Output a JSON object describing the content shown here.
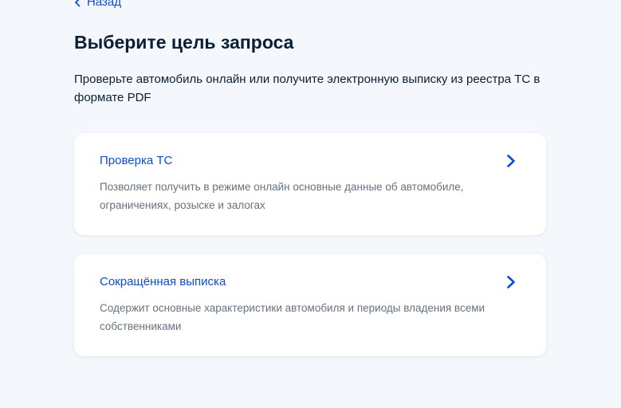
{
  "navigation": {
    "back_label": "Назад",
    "back_icon": "chevron-left-icon"
  },
  "header": {
    "title": "Выберите цель запроса",
    "subtitle": "Проверьте автомобиль онлайн или получите электронную выписку из реестра ТС в формате PDF"
  },
  "options": [
    {
      "title": "Проверка ТС",
      "description": "Позволяет получить в режиме онлайн основные данные об автомобиле, ограничениях, розыске и залогах",
      "icon": "chevron-right-icon"
    },
    {
      "title": "Сокращённая выписка",
      "description": "Содержит основные характеристики автомобиля и периоды владения всеми собственниками",
      "icon": "chevron-right-icon"
    }
  ],
  "colors": {
    "background": "#f4f7fc",
    "card": "#ffffff",
    "link": "#0d4cd3",
    "text": "#0b1f33",
    "muted": "#66727f"
  }
}
